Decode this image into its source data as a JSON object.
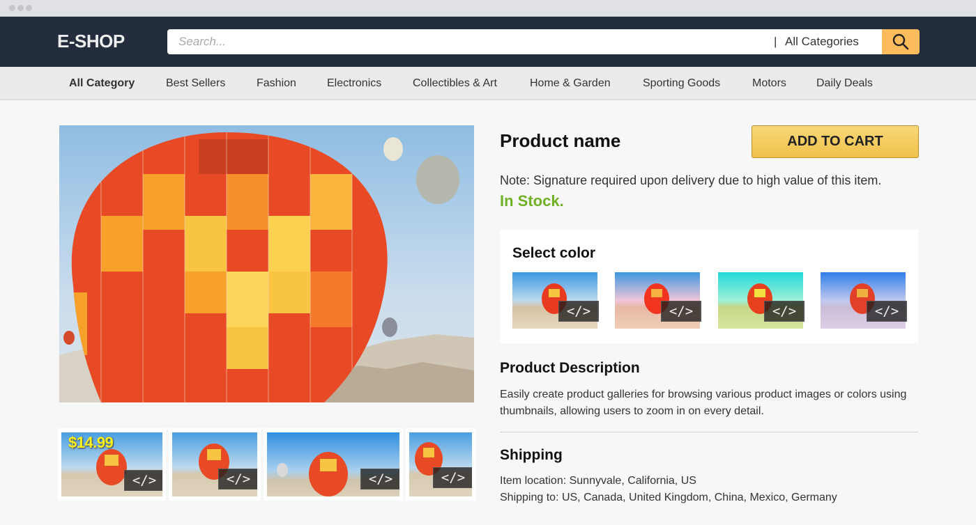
{
  "window": {
    "controls": [
      "close",
      "minimize",
      "maximize"
    ]
  },
  "header": {
    "logo": "E-SHOP",
    "search_placeholder": "Search...",
    "search_value": "",
    "category_separator": "|",
    "category_selected": "All Categories",
    "search_button_icon": "search-icon",
    "accent_color": "#fdbc5c",
    "background_color": "#232d3d"
  },
  "nav": {
    "items": [
      {
        "label": "All Category",
        "active": true
      },
      {
        "label": "Best Sellers"
      },
      {
        "label": "Fashion"
      },
      {
        "label": "Electronics"
      },
      {
        "label": "Collectibles & Art"
      },
      {
        "label": "Home & Garden"
      },
      {
        "label": "Sporting Goods"
      },
      {
        "label": "Motors"
      },
      {
        "label": "Daily Deals"
      }
    ]
  },
  "gallery": {
    "main_image_alt": "Hot air balloon over Cappadocia",
    "thumbnails": [
      {
        "price_label": "$14.99",
        "badge": "</>"
      },
      {
        "badge": "</>"
      },
      {
        "badge": "</>"
      },
      {
        "badge": "</>"
      }
    ]
  },
  "product": {
    "name": "Product name",
    "add_to_cart_label": "ADD TO CART",
    "note": "Note: Signature required upon delivery due to high value of this item.",
    "stock_status": "In Stock.",
    "stock_color": "#6fb025"
  },
  "color_select": {
    "title": "Select color",
    "swatches": [
      {
        "name": "original",
        "badge": "</>"
      },
      {
        "name": "pink",
        "badge": "</>"
      },
      {
        "name": "green",
        "badge": "</>"
      },
      {
        "name": "purple",
        "badge": "</>"
      }
    ]
  },
  "description": {
    "title": "Product Description",
    "text": "Easily create product galleries for browsing various product images or colors using thumbnails, allowing users to zoom in on every detail."
  },
  "shipping": {
    "title": "Shipping",
    "location": "Item location: Sunnyvale, California, US",
    "destinations": "Shipping to: US, Canada, United Kingdom, China, Mexico, Germany"
  }
}
